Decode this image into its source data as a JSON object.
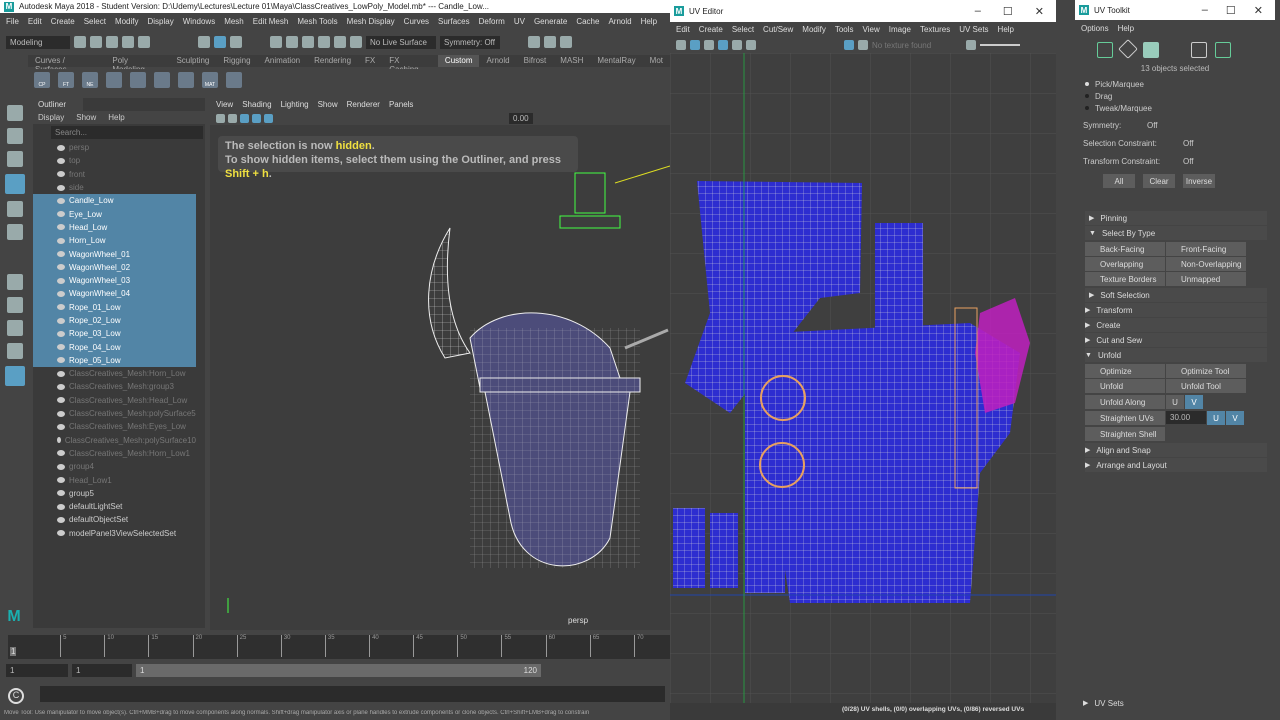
{
  "main": {
    "title": "Autodesk Maya 2018 - Student Version: D:\\Udemy\\Lectures\\Lecture 01\\Maya\\ClassCreatives_LowPoly_Model.mb*  ---  Candle_Low...",
    "menu": [
      "File",
      "Edit",
      "Create",
      "Select",
      "Modify",
      "Display",
      "Windows",
      "Mesh",
      "Edit Mesh",
      "Mesh Tools",
      "Mesh Display",
      "Curves",
      "Surfaces",
      "Deform",
      "UV",
      "Generate",
      "Cache",
      "Arnold",
      "Help"
    ],
    "mode": "Modeling",
    "live_surface": "No Live Surface",
    "symmetry": "Symmetry: Off",
    "shelf_tabs": [
      "Curves / Surfaces",
      "Poly Modeling",
      "Sculpting",
      "Rigging",
      "Animation",
      "Rendering",
      "FX",
      "FX Caching",
      "Custom",
      "Arnold",
      "Bifrost",
      "MASH",
      "MentalRay",
      "Mot"
    ],
    "active_shelf": "Custom",
    "shelf_icons": [
      "CP",
      "FT",
      "NE",
      "",
      "",
      "",
      "",
      "MAT",
      ""
    ]
  },
  "outliner": {
    "title": "Outliner",
    "menu": [
      "Display",
      "Show",
      "Help"
    ],
    "search_placeholder": "Search...",
    "items": [
      {
        "label": "persp",
        "state": "dim"
      },
      {
        "label": "top",
        "state": "dim"
      },
      {
        "label": "front",
        "state": "dim"
      },
      {
        "label": "side",
        "state": "dim"
      },
      {
        "label": "Candle_Low",
        "state": "sel"
      },
      {
        "label": "Eye_Low",
        "state": "sel"
      },
      {
        "label": "Head_Low",
        "state": "sel"
      },
      {
        "label": "Horn_Low",
        "state": "sel"
      },
      {
        "label": "WagonWheel_01",
        "state": "sel"
      },
      {
        "label": "WagonWheel_02",
        "state": "sel"
      },
      {
        "label": "WagonWheel_03",
        "state": "sel"
      },
      {
        "label": "WagonWheel_04",
        "state": "sel"
      },
      {
        "label": "Rope_01_Low",
        "state": "sel"
      },
      {
        "label": "Rope_02_Low",
        "state": "sel"
      },
      {
        "label": "Rope_03_Low",
        "state": "sel"
      },
      {
        "label": "Rope_04_Low",
        "state": "sel"
      },
      {
        "label": "Rope_05_Low",
        "state": "sel"
      },
      {
        "label": "ClassCreatives_Mesh:Horn_Low",
        "state": "dim"
      },
      {
        "label": "ClassCreatives_Mesh:group3",
        "state": "dim"
      },
      {
        "label": "ClassCreatives_Mesh:Head_Low",
        "state": "dim"
      },
      {
        "label": "ClassCreatives_Mesh:polySurface5",
        "state": "dim"
      },
      {
        "label": "ClassCreatives_Mesh:Eyes_Low",
        "state": "dim"
      },
      {
        "label": "ClassCreatives_Mesh:polySurface10",
        "state": "dim"
      },
      {
        "label": "ClassCreatives_Mesh:Horn_Low1",
        "state": "dim"
      },
      {
        "label": "group4",
        "state": "dim"
      },
      {
        "label": "Head_Low1",
        "state": "dim"
      },
      {
        "label": "group5",
        "state": "normal"
      },
      {
        "label": "defaultLightSet",
        "state": "normal"
      },
      {
        "label": "defaultObjectSet",
        "state": "normal"
      },
      {
        "label": "modelPanel3ViewSelectedSet",
        "state": "normal"
      }
    ]
  },
  "viewport": {
    "menu": [
      "View",
      "Shading",
      "Lighting",
      "Show",
      "Renderer",
      "Panels"
    ],
    "value": "0.00",
    "msg_prefix": "The selection is now ",
    "msg_hl": "hidden",
    "msg_end": ".",
    "msg2_prefix": "To show hidden items, select them using the Outliner, and press ",
    "msg2_hl": "Shift + h",
    "msg2_end": ".",
    "camera": "persp"
  },
  "timeline": {
    "ticks": [
      "5",
      "10",
      "15",
      "20",
      "25",
      "30",
      "35",
      "40",
      "45",
      "50",
      "55",
      "60",
      "65",
      "70"
    ],
    "current": "1",
    "start": "1",
    "start2": "1",
    "range_start": "1",
    "range_end": "120"
  },
  "help_line": "Move Tool: Use manipulator to move object(s). Ctrl+MMB+drag to move components along normals. Shift+drag manipulator axis or plane handles to extrude components or clone objects. Ctrl+Shift+LMB+drag to constrain",
  "uv_editor": {
    "title": "UV Editor",
    "menu": [
      "Edit",
      "Create",
      "Select",
      "Cut/Sew",
      "Modify",
      "Tools",
      "View",
      "Image",
      "Textures",
      "UV Sets",
      "Help"
    ],
    "texture": "No texture found",
    "status": "(0/28) UV shells, (0/0) overlapping UVs, (0/86) reversed UVs"
  },
  "uv_toolkit": {
    "title": "UV Toolkit",
    "menu": [
      "Options",
      "Help"
    ],
    "selected": "13 objects selected",
    "modes": [
      "Pick/Marquee",
      "Drag",
      "Tweak/Marquee"
    ],
    "symmetry_label": "Symmetry:",
    "symmetry": "Off",
    "sel_constraint_label": "Selection Constraint:",
    "sel_constraint": "Off",
    "tr_constraint_label": "Transform Constraint:",
    "tr_constraint": "Off",
    "buttons": [
      "All",
      "Clear",
      "Inverse"
    ],
    "pinning": "Pinning",
    "select_by_type": "Select By Type",
    "types": [
      "Back-Facing",
      "Front-Facing",
      "Overlapping",
      "Non-Overlapping",
      "Texture Borders",
      "Unmapped"
    ],
    "soft_selection": "Soft Selection",
    "sections": [
      "Transform",
      "Create",
      "Cut and Sew"
    ],
    "unfold": "Unfold",
    "unfold_btns": [
      "Optimize",
      "Optimize Tool",
      "Unfold",
      "Unfold Tool",
      "Unfold Along"
    ],
    "u": "U",
    "v": "V",
    "straighten": "Straighten UVs",
    "straighten_val": "30.00",
    "straighten_shell": "Straighten Shell",
    "sections2": [
      "Align and Snap",
      "Arrange and Layout"
    ],
    "uv_sets": "UV Sets"
  },
  "colors": {
    "selection": "#5285a6",
    "uv_shell": "#2d2dd0",
    "highlight": "#f0e040",
    "accent": "#1a9c9c"
  }
}
